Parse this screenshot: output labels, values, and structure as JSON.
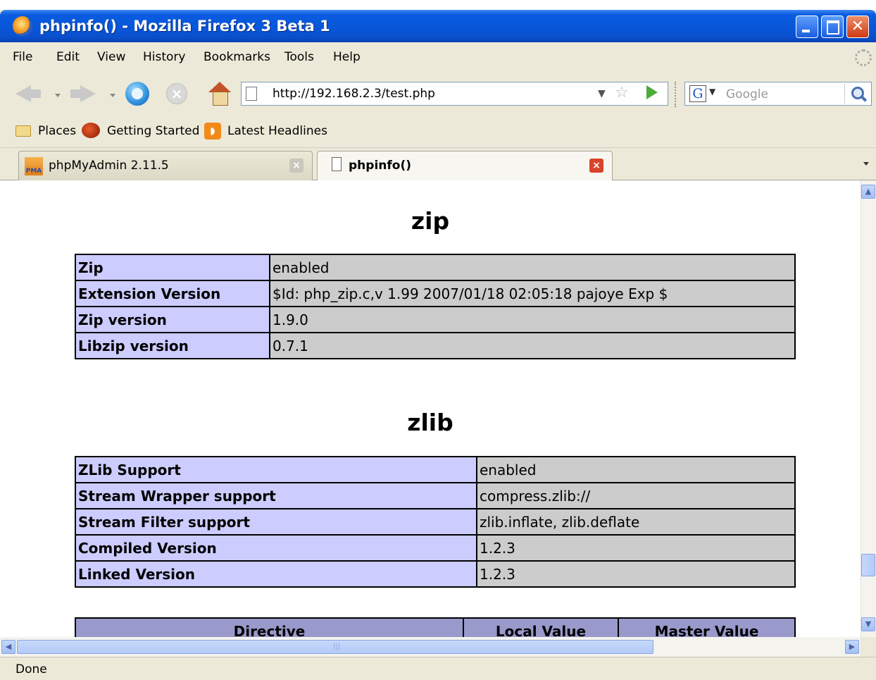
{
  "window": {
    "title": "phpinfo() - Mozilla Firefox 3 Beta 1",
    "close_glyph": "✕"
  },
  "menu": [
    "File",
    "Edit",
    "View",
    "History",
    "Bookmarks",
    "Tools",
    "Help"
  ],
  "nav": {
    "url": "http://192.168.2.3/test.php",
    "search_placeholder": "Google",
    "search_engine_letter": "G"
  },
  "bookmarks": [
    "Places",
    "Getting Started",
    "Latest Headlines"
  ],
  "tabs": [
    {
      "label": "phpMyAdmin 2.11.5",
      "icon": "pma-icon",
      "active": false
    },
    {
      "label": "phpinfo()",
      "icon": "page-icon",
      "active": true
    }
  ],
  "sections": {
    "zip": {
      "title": "zip",
      "rows": [
        {
          "name": "Zip",
          "value": "enabled"
        },
        {
          "name": "Extension Version",
          "value": "$Id: php_zip.c,v 1.99 2007/01/18 02:05:18 pajoye Exp $"
        },
        {
          "name": "Zip version",
          "value": "1.9.0"
        },
        {
          "name": "Libzip version",
          "value": "0.7.1"
        }
      ]
    },
    "zlib": {
      "title": "zlib",
      "rows": [
        {
          "name": "ZLib Support",
          "value": "enabled"
        },
        {
          "name": "Stream Wrapper support",
          "value": "compress.zlib://"
        },
        {
          "name": "Stream Filter support",
          "value": "zlib.inflate, zlib.deflate"
        },
        {
          "name": "Compiled Version",
          "value": "1.2.3"
        },
        {
          "name": "Linked Version",
          "value": "1.2.3"
        }
      ],
      "directive_headers": [
        "Directive",
        "Local Value",
        "Master Value"
      ]
    }
  },
  "status": "Done",
  "colors": {
    "row_name_bg": "#ccccff",
    "row_value_bg": "#cccccc",
    "header_bg": "#9999cc",
    "titlebar_blue": "#0856d8"
  }
}
